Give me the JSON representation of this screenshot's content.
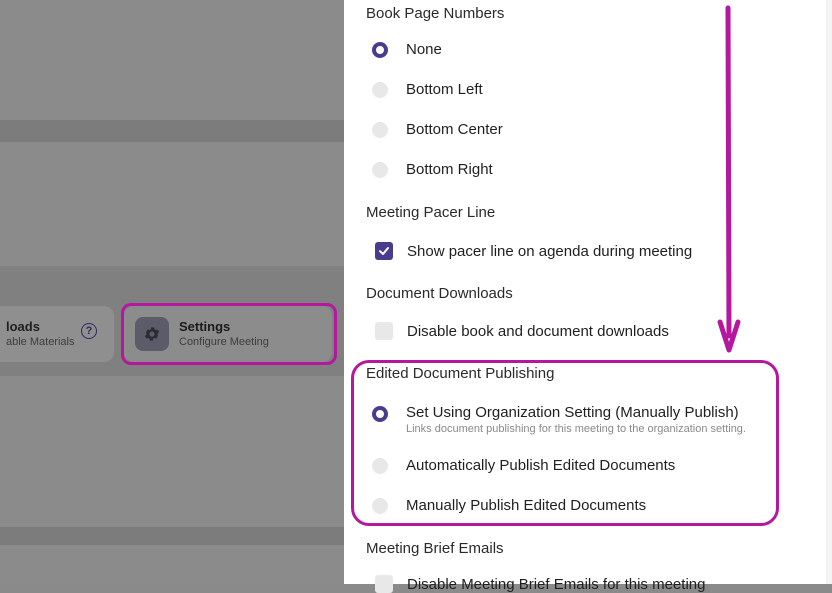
{
  "colors": {
    "accent": "#4b3b8c",
    "annotation": "#b5179e"
  },
  "backdrop": {
    "downloads_card": {
      "title": "loads",
      "subtitle": "able Materials",
      "help_glyph": "?"
    },
    "settings_card": {
      "title": "Settings",
      "subtitle": "Configure Meeting",
      "icon": "gear-icon"
    }
  },
  "panel": {
    "book_page_numbers": {
      "title": "Book Page Numbers",
      "options": [
        {
          "label": "None",
          "selected": true
        },
        {
          "label": "Bottom Left",
          "selected": false
        },
        {
          "label": "Bottom Center",
          "selected": false
        },
        {
          "label": "Bottom Right",
          "selected": false
        }
      ]
    },
    "meeting_pacer_line": {
      "title": "Meeting Pacer Line",
      "checkbox": {
        "label": "Show pacer line on agenda during meeting",
        "checked": true
      }
    },
    "document_downloads": {
      "title": "Document Downloads",
      "checkbox": {
        "label": "Disable book and document downloads",
        "checked": false
      }
    },
    "edited_document_publishing": {
      "title": "Edited Document Publishing",
      "options": [
        {
          "label": "Set Using Organization Setting (Manually Publish)",
          "sublabel": "Links document publishing for this meeting to the organization setting.",
          "selected": true
        },
        {
          "label": "Automatically Publish Edited Documents",
          "selected": false
        },
        {
          "label": "Manually Publish Edited Documents",
          "selected": false
        }
      ]
    },
    "meeting_brief_emails": {
      "title": "Meeting Brief Emails",
      "checkbox": {
        "label": "Disable Meeting Brief Emails for this meeting",
        "checked": false
      }
    }
  }
}
